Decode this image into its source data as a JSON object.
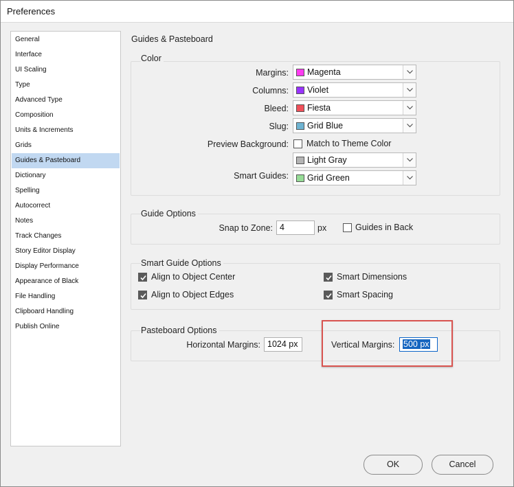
{
  "window": {
    "title": "Preferences"
  },
  "sidebar": {
    "items": [
      {
        "label": "General"
      },
      {
        "label": "Interface"
      },
      {
        "label": "UI Scaling"
      },
      {
        "label": "Type"
      },
      {
        "label": "Advanced Type"
      },
      {
        "label": "Composition"
      },
      {
        "label": "Units & Increments"
      },
      {
        "label": "Grids"
      },
      {
        "label": "Guides & Pasteboard",
        "selected": true
      },
      {
        "label": "Dictionary"
      },
      {
        "label": "Spelling"
      },
      {
        "label": "Autocorrect"
      },
      {
        "label": "Notes"
      },
      {
        "label": "Track Changes"
      },
      {
        "label": "Story Editor Display"
      },
      {
        "label": "Display Performance"
      },
      {
        "label": "Appearance of Black"
      },
      {
        "label": "File Handling"
      },
      {
        "label": "Clipboard Handling"
      },
      {
        "label": "Publish Online"
      }
    ]
  },
  "section_title": "Guides & Pasteboard",
  "color": {
    "legend": "Color",
    "margins": {
      "label": "Margins:",
      "value": "Magenta",
      "swatch": "#ff3cf0"
    },
    "columns": {
      "label": "Columns:",
      "value": "Violet",
      "swatch": "#9933ff"
    },
    "bleed": {
      "label": "Bleed:",
      "value": "Fiesta",
      "swatch": "#f0505a"
    },
    "slug": {
      "label": "Slug:",
      "value": "Grid Blue",
      "swatch": "#6fb4d2"
    },
    "preview_background": {
      "label": "Preview Background:",
      "checkbox_label": "Match to Theme Color",
      "checked": false,
      "value": "Light Gray",
      "swatch": "#b4b4b4"
    },
    "smart_guides": {
      "label": "Smart Guides:",
      "value": "Grid Green",
      "swatch": "#96dc96"
    }
  },
  "guide_options": {
    "legend": "Guide Options",
    "snap_label": "Snap to Zone:",
    "snap_value": "4",
    "snap_unit": "px",
    "guides_in_back": {
      "label": "Guides in Back",
      "checked": false
    }
  },
  "smart_guide_options": {
    "legend": "Smart Guide Options",
    "align_center": {
      "label": "Align to Object Center",
      "checked": true
    },
    "align_edges": {
      "label": "Align to Object Edges",
      "checked": true
    },
    "smart_dimensions": {
      "label": "Smart Dimensions",
      "checked": true
    },
    "smart_spacing": {
      "label": "Smart Spacing",
      "checked": true
    }
  },
  "pasteboard_options": {
    "legend": "Pasteboard Options",
    "horizontal_label": "Horizontal Margins:",
    "horizontal_value": "1024 px",
    "vertical_label": "Vertical Margins:",
    "vertical_value": "500 px"
  },
  "buttons": {
    "ok": "OK",
    "cancel": "Cancel"
  },
  "colors": {
    "selection": "#c1d8f1",
    "highlight": "#d9534f",
    "text_selection": "#1565c0"
  }
}
